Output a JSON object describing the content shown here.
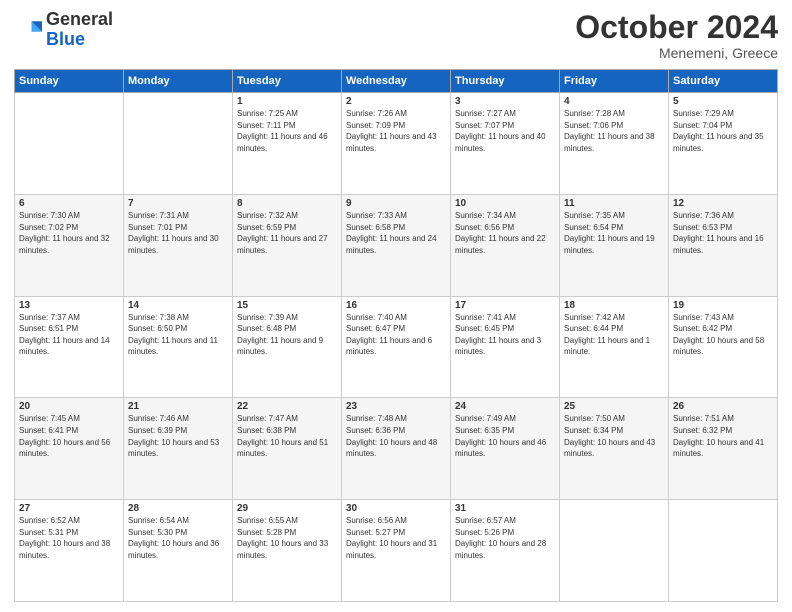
{
  "header": {
    "logo": {
      "general": "General",
      "blue": "Blue"
    },
    "title": "October 2024",
    "location": "Menemeni, Greece"
  },
  "days_of_week": [
    "Sunday",
    "Monday",
    "Tuesday",
    "Wednesday",
    "Thursday",
    "Friday",
    "Saturday"
  ],
  "weeks": [
    [
      {
        "day": null,
        "info": null
      },
      {
        "day": null,
        "info": null
      },
      {
        "day": "1",
        "sunrise": "7:25 AM",
        "sunset": "7:11 PM",
        "daylight": "11 hours and 46 minutes."
      },
      {
        "day": "2",
        "sunrise": "7:26 AM",
        "sunset": "7:09 PM",
        "daylight": "11 hours and 43 minutes."
      },
      {
        "day": "3",
        "sunrise": "7:27 AM",
        "sunset": "7:07 PM",
        "daylight": "11 hours and 40 minutes."
      },
      {
        "day": "4",
        "sunrise": "7:28 AM",
        "sunset": "7:06 PM",
        "daylight": "11 hours and 38 minutes."
      },
      {
        "day": "5",
        "sunrise": "7:29 AM",
        "sunset": "7:04 PM",
        "daylight": "11 hours and 35 minutes."
      }
    ],
    [
      {
        "day": "6",
        "sunrise": "7:30 AM",
        "sunset": "7:02 PM",
        "daylight": "11 hours and 32 minutes."
      },
      {
        "day": "7",
        "sunrise": "7:31 AM",
        "sunset": "7:01 PM",
        "daylight": "11 hours and 30 minutes."
      },
      {
        "day": "8",
        "sunrise": "7:32 AM",
        "sunset": "6:59 PM",
        "daylight": "11 hours and 27 minutes."
      },
      {
        "day": "9",
        "sunrise": "7:33 AM",
        "sunset": "6:58 PM",
        "daylight": "11 hours and 24 minutes."
      },
      {
        "day": "10",
        "sunrise": "7:34 AM",
        "sunset": "6:56 PM",
        "daylight": "11 hours and 22 minutes."
      },
      {
        "day": "11",
        "sunrise": "7:35 AM",
        "sunset": "6:54 PM",
        "daylight": "11 hours and 19 minutes."
      },
      {
        "day": "12",
        "sunrise": "7:36 AM",
        "sunset": "6:53 PM",
        "daylight": "11 hours and 16 minutes."
      }
    ],
    [
      {
        "day": "13",
        "sunrise": "7:37 AM",
        "sunset": "6:51 PM",
        "daylight": "11 hours and 14 minutes."
      },
      {
        "day": "14",
        "sunrise": "7:38 AM",
        "sunset": "6:50 PM",
        "daylight": "11 hours and 11 minutes."
      },
      {
        "day": "15",
        "sunrise": "7:39 AM",
        "sunset": "6:48 PM",
        "daylight": "11 hours and 9 minutes."
      },
      {
        "day": "16",
        "sunrise": "7:40 AM",
        "sunset": "6:47 PM",
        "daylight": "11 hours and 6 minutes."
      },
      {
        "day": "17",
        "sunrise": "7:41 AM",
        "sunset": "6:45 PM",
        "daylight": "11 hours and 3 minutes."
      },
      {
        "day": "18",
        "sunrise": "7:42 AM",
        "sunset": "6:44 PM",
        "daylight": "11 hours and 1 minute."
      },
      {
        "day": "19",
        "sunrise": "7:43 AM",
        "sunset": "6:42 PM",
        "daylight": "10 hours and 58 minutes."
      }
    ],
    [
      {
        "day": "20",
        "sunrise": "7:45 AM",
        "sunset": "6:41 PM",
        "daylight": "10 hours and 56 minutes."
      },
      {
        "day": "21",
        "sunrise": "7:46 AM",
        "sunset": "6:39 PM",
        "daylight": "10 hours and 53 minutes."
      },
      {
        "day": "22",
        "sunrise": "7:47 AM",
        "sunset": "6:38 PM",
        "daylight": "10 hours and 51 minutes."
      },
      {
        "day": "23",
        "sunrise": "7:48 AM",
        "sunset": "6:36 PM",
        "daylight": "10 hours and 48 minutes."
      },
      {
        "day": "24",
        "sunrise": "7:49 AM",
        "sunset": "6:35 PM",
        "daylight": "10 hours and 46 minutes."
      },
      {
        "day": "25",
        "sunrise": "7:50 AM",
        "sunset": "6:34 PM",
        "daylight": "10 hours and 43 minutes."
      },
      {
        "day": "26",
        "sunrise": "7:51 AM",
        "sunset": "6:32 PM",
        "daylight": "10 hours and 41 minutes."
      }
    ],
    [
      {
        "day": "27",
        "sunrise": "6:52 AM",
        "sunset": "5:31 PM",
        "daylight": "10 hours and 38 minutes."
      },
      {
        "day": "28",
        "sunrise": "6:54 AM",
        "sunset": "5:30 PM",
        "daylight": "10 hours and 36 minutes."
      },
      {
        "day": "29",
        "sunrise": "6:55 AM",
        "sunset": "5:28 PM",
        "daylight": "10 hours and 33 minutes."
      },
      {
        "day": "30",
        "sunrise": "6:56 AM",
        "sunset": "5:27 PM",
        "daylight": "10 hours and 31 minutes."
      },
      {
        "day": "31",
        "sunrise": "6:57 AM",
        "sunset": "5:26 PM",
        "daylight": "10 hours and 28 minutes."
      },
      {
        "day": null,
        "info": null
      },
      {
        "day": null,
        "info": null
      }
    ]
  ],
  "labels": {
    "sunrise": "Sunrise:",
    "sunset": "Sunset:",
    "daylight": "Daylight:"
  }
}
